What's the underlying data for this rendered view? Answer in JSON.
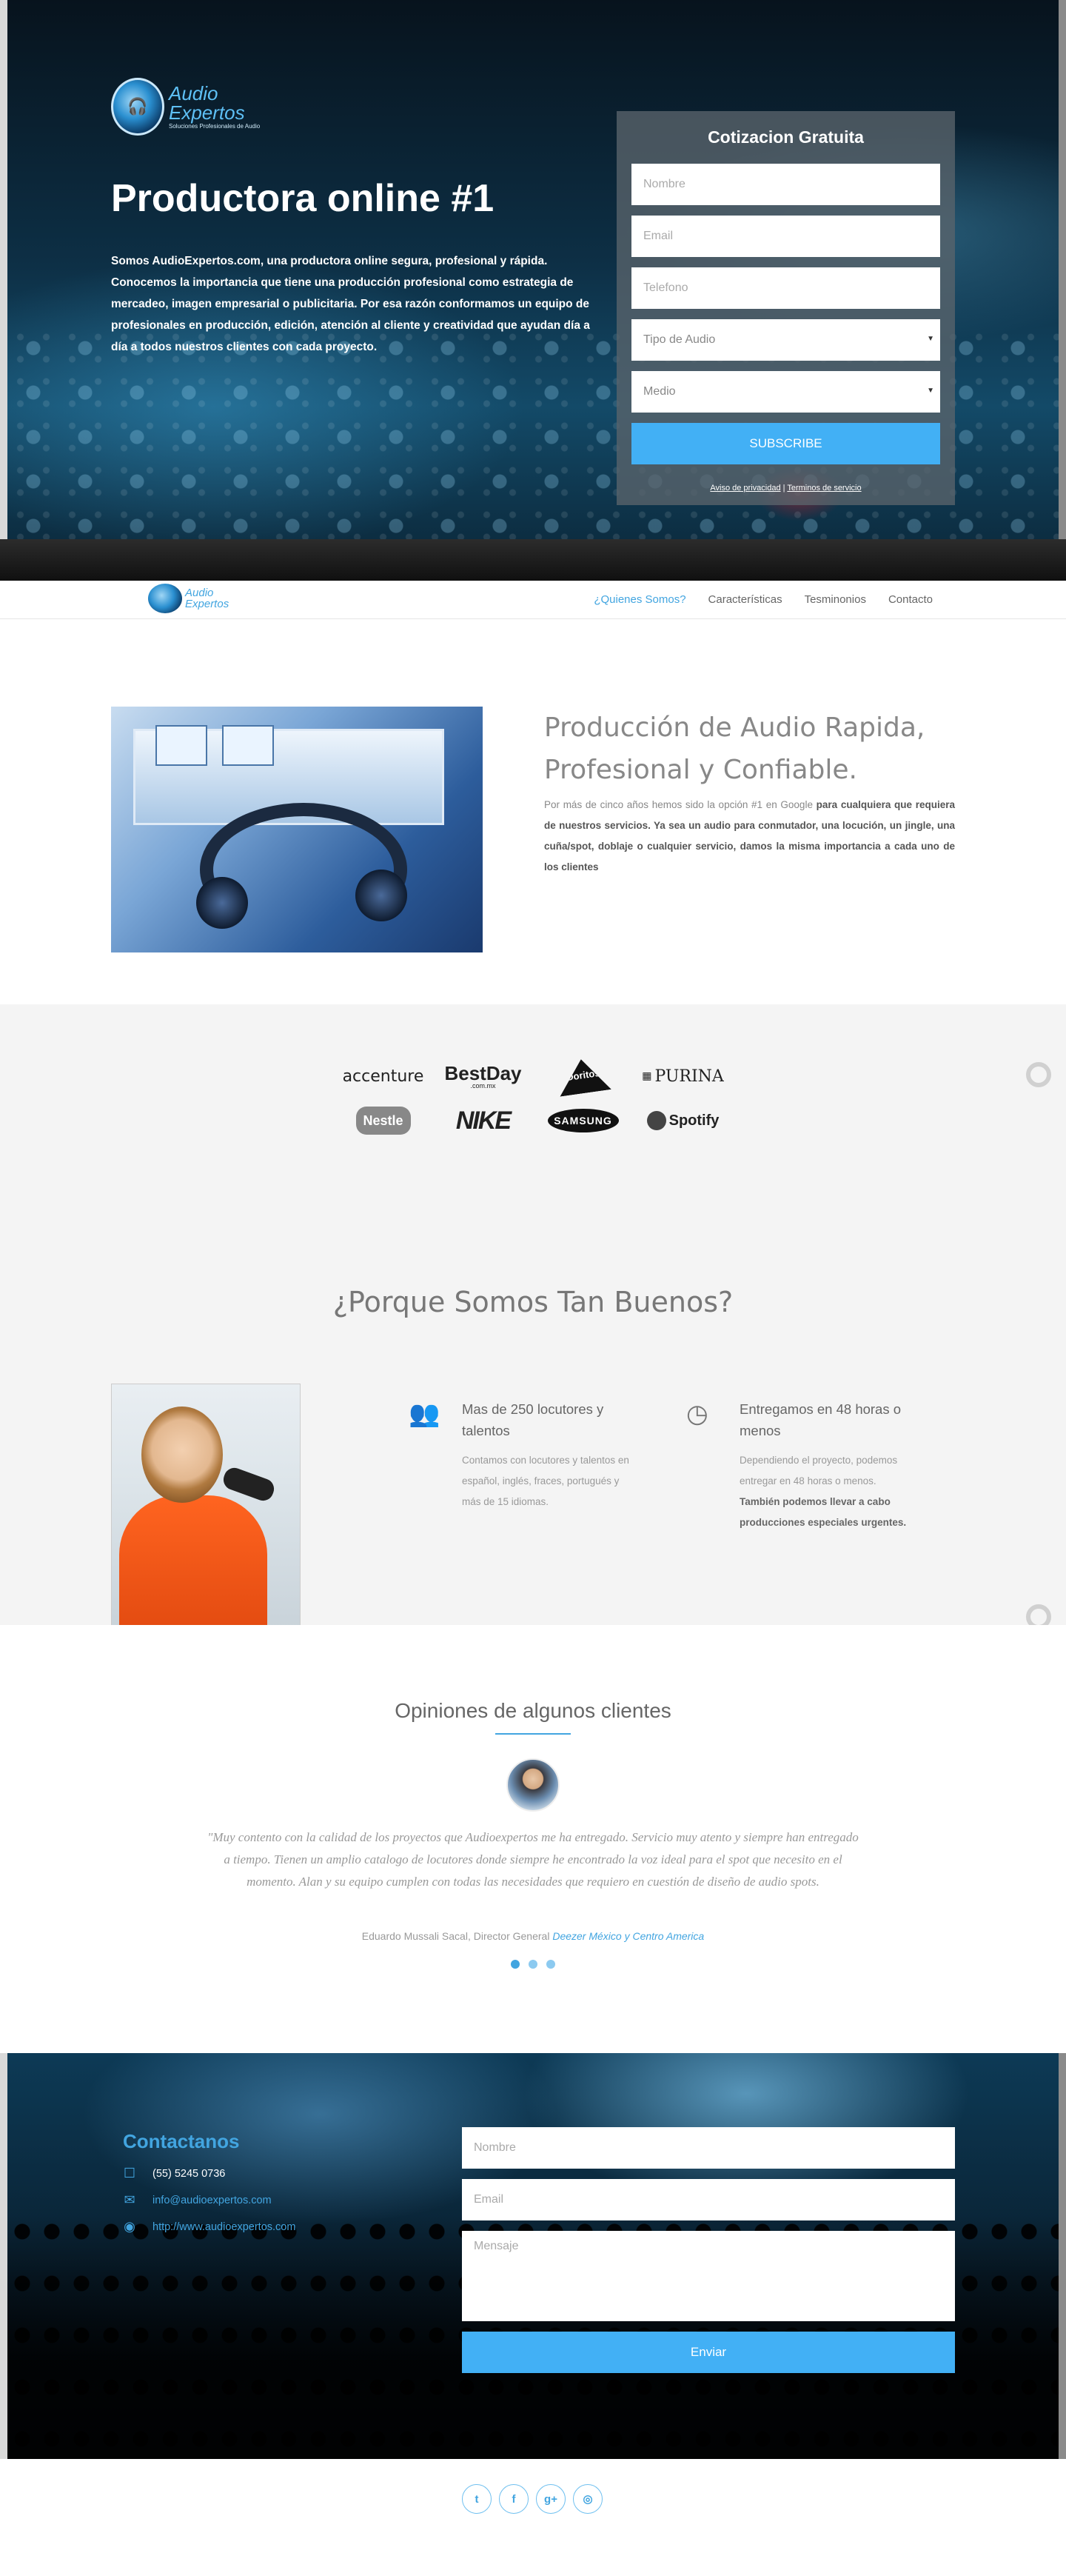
{
  "brand": {
    "logo_line1": "Audio",
    "logo_line2": "Expertos",
    "logo_tagline": "Soluciones Profesionales de Audio"
  },
  "hero": {
    "title": "Productora online #1",
    "description": "Somos AudioExpertos.com, una productora online segura, profesional y rápida. Conocemos la importancia que tiene una producción profesional como estrategia de mercadeo, imagen empresarial o publicitaria. Por esa razón conformamos un equipo de profesionales en producción, edición, atención al cliente y creatividad que ayudan día a día a todos nuestros clientes con cada proyecto."
  },
  "quote_form": {
    "title": "Cotizacion Gratuita",
    "name_placeholder": "Nombre",
    "email_placeholder": "Email",
    "phone_placeholder": "Telefono",
    "audio_type_select": "Tipo de Audio",
    "medium_select": "Medio",
    "submit_label": "SUBSCRIBE",
    "privacy_link": "Aviso de privacidad",
    "separator": "|",
    "terms_link": "Terminos de servicio"
  },
  "nav": {
    "items": [
      {
        "label": "¿Quienes Somos?",
        "active": true
      },
      {
        "label": "Características",
        "active": false
      },
      {
        "label": "Tesminonios",
        "active": false
      },
      {
        "label": "Contacto",
        "active": false
      }
    ]
  },
  "about": {
    "title": "Producción de Audio Rapida, Profesional y Confiable.",
    "text_plain": "Por más de cinco años hemos sido la opción #1 en Google ",
    "text_bold": "para cualquiera que requiera de nuestros servicios. Ya sea un audio para conmutador, una locución, un jingle, una cuña/spot, doblaje o cualquier servicio, damos la misma importancia a cada uno de los clientes"
  },
  "clients": {
    "logos": [
      "accenture",
      "BestDay",
      "Doritos",
      "PURINA",
      "Nestle",
      "NIKE",
      "SAMSUNG",
      "Spotify"
    ],
    "bestday_sub": ".com.mx"
  },
  "why": {
    "title": "¿Porque Somos Tan Buenos?",
    "features": [
      {
        "icon": "users-icon",
        "title": "Mas de 250 locutores y talentos",
        "text": "Contamos con locutores y talentos en español, inglés, fraces, portugués y más de 15 idiomas.",
        "bold": ""
      },
      {
        "icon": "clock-icon",
        "title": "Entregamos en 48 horas o menos",
        "text": "Dependiendo el proyecto, podemos entregar en 48 horas o menos. ",
        "bold": "También podemos llevar a cabo producciones especiales urgentes."
      }
    ]
  },
  "testimonials": {
    "title": "Opiniones de algunos clientes",
    "quote": "\"Muy contento con la calidad de los proyectos que Audioexpertos me ha entregado. Servicio muy atento y siempre han entregado a tiempo. Tienen un amplio catalogo de locutores donde siempre he encontrado la voz ideal para el spot que necesito en el momento. Alan y su equipo cumplen con todas las necesidades que requiero en cuestión de diseño de audio spots.",
    "author": "Eduardo Mussali Sacal, Director General ",
    "company": "Deezer México y Centro America",
    "dots": 3
  },
  "contact": {
    "title": "Contactanos",
    "phone": "(55) 5245 0736",
    "email": "info@audioexpertos.com",
    "website": "http://www.audioexpertos.com",
    "name_placeholder": "Nombre",
    "email_placeholder": "Email",
    "message_placeholder": "Mensaje",
    "send_label": "Enviar"
  },
  "footer": {
    "socials": [
      {
        "name": "twitter-icon",
        "glyph": "t"
      },
      {
        "name": "facebook-icon",
        "glyph": "f"
      },
      {
        "name": "google-plus-icon",
        "glyph": "g+"
      },
      {
        "name": "instagram-icon",
        "glyph": "◎"
      }
    ]
  },
  "colors": {
    "accent": "#42b0f5",
    "link": "#42a5e0"
  }
}
